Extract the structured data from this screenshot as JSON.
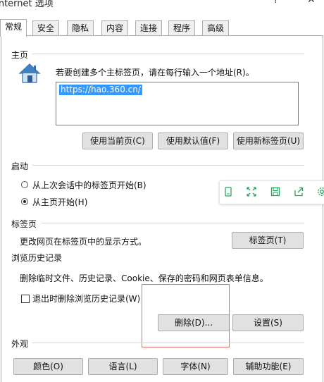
{
  "window": {
    "title": "Internet 选项",
    "help_glyph": "?",
    "close_glyph": "✕"
  },
  "tabs": [
    "常规",
    "安全",
    "隐私",
    "内容",
    "连接",
    "程序",
    "高级"
  ],
  "homepage": {
    "section_label": "主页",
    "instruction": "若要创建多个主标签页，请在每行输入一个地址(R)。",
    "url_value": "https://hao.360.cn/",
    "buttons": [
      "使用当前页(C)",
      "使用默认值(F)",
      "使用新标签页(U)"
    ]
  },
  "startup": {
    "section_label": "启动",
    "option_last_session": "从上次会话中的标签页开始(B)",
    "option_homepage": "从主页开始(H)",
    "selected": "homepage"
  },
  "tabs_section": {
    "section_label": "标签页",
    "description": "更改网页在标签页中的显示方式。",
    "button": "标签页(T)"
  },
  "history": {
    "section_label": "浏览历史记录",
    "description": "删除临时文件、历史记录、Cookie、保存的密码和网页表单信息。",
    "checkbox_label": "退出时删除浏览历史记录(W)",
    "checkbox_checked": false,
    "delete_button": "删除(D)...",
    "settings_button": "设置(S)"
  },
  "appearance": {
    "section_label": "外观",
    "buttons": [
      "颜色(O)",
      "语言(L)",
      "字体(N)",
      "辅助功能(E)"
    ]
  },
  "float_toolbar": {
    "icons": [
      "tablet-icon",
      "expand-icon",
      "save-icon",
      "share-icon",
      "settings-icon"
    ]
  },
  "colors": {
    "accent": "#3399ff",
    "annotation": "#e26b6b",
    "toolbar_icon": "#26a35e"
  }
}
